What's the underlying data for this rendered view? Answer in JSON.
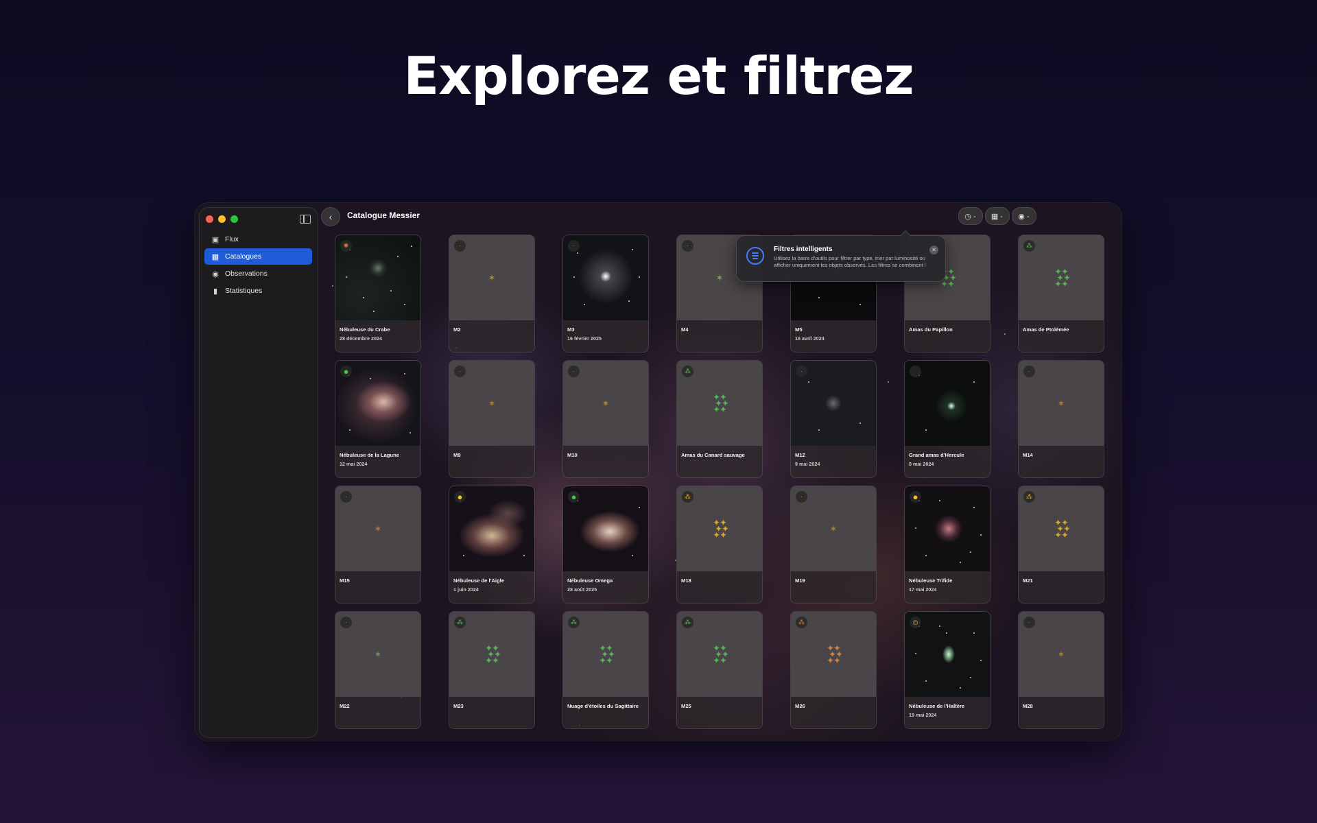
{
  "headline": "Explorez et filtrez",
  "window": {
    "title": "Catalogue Messier",
    "sidebar": {
      "items": [
        {
          "label": "Flux",
          "icon": "photo-stack-icon",
          "glyph": "▣",
          "active": false
        },
        {
          "label": "Catalogues",
          "icon": "photo-grid-icon",
          "glyph": "▦",
          "active": true
        },
        {
          "label": "Observations",
          "icon": "eye-icon",
          "glyph": "◉",
          "active": false
        },
        {
          "label": "Statistiques",
          "icon": "bar-chart-icon",
          "glyph": "▮",
          "active": false
        }
      ]
    },
    "toolbar": {
      "back_glyph": "‹",
      "buttons": [
        {
          "name": "season-filter-button",
          "icon": "clock-filter-icon",
          "glyph": "◷"
        },
        {
          "name": "layout-button",
          "icon": "grid-view-icon",
          "glyph": "▦"
        },
        {
          "name": "visibility-button",
          "icon": "eye-icon",
          "glyph": "◉"
        }
      ],
      "chevron": "⌄"
    },
    "tooltip": {
      "title": "Filtres intelligents",
      "body": "Utilisez la barre d'outils pour filtrer par type, trier par luminosité ou afficher uniquement les objets observés. Les filtres se combinent !",
      "close_glyph": "✕"
    },
    "cards": [
      {
        "name": "Nébuleuse du Crabe",
        "date": "28 décembre 2024",
        "photo": "nebula-small",
        "badge": "supernova",
        "badge_glyph": "✺",
        "badge_color": "#e07a3a"
      },
      {
        "name": "M2",
        "date": "",
        "photo": "",
        "badge": "dim",
        "badge_glyph": "·",
        "badge_color": "#b0a020",
        "glyph": "✶",
        "glyph_color": "#b8a030",
        "glyph_type": "dim"
      },
      {
        "name": "M3",
        "date": "16 février 2025",
        "photo": "globular",
        "badge": "dim",
        "badge_glyph": "·",
        "badge_color": "#9a9a40"
      },
      {
        "name": "M4",
        "date": "",
        "photo": "",
        "badge": "dim",
        "badge_glyph": "·",
        "badge_color": "#8aa060",
        "glyph": "✶",
        "glyph_color": "#8ab060",
        "glyph_type": "dim"
      },
      {
        "name": "M5",
        "date": "16 avril 2024",
        "photo": "globular-small",
        "badge": "dim",
        "badge_glyph": "·",
        "badge_color": "#777"
      },
      {
        "name": "Amas du Papillon",
        "date": "",
        "photo": "",
        "badge": "cluster",
        "badge_glyph": "⁂",
        "badge_color": "#5ab05a",
        "glyph": "✦✦",
        "glyph_color": "#5ab05a",
        "glyph_type": "stars"
      },
      {
        "name": "Amas de Ptolémée",
        "date": "",
        "photo": "",
        "badge": "cluster",
        "badge_glyph": "⁂",
        "badge_color": "#5ab05a",
        "glyph": "✦✦",
        "glyph_color": "#5ab05a",
        "glyph_type": "stars"
      },
      {
        "name": "Nébuleuse de la Lagune",
        "date": "12 mai 2024",
        "photo": "lagoon",
        "badge": "nebula-green",
        "badge_glyph": "●",
        "badge_color": "#4cc04c"
      },
      {
        "name": "M9",
        "date": "",
        "photo": "",
        "badge": "dim",
        "badge_glyph": "·",
        "badge_color": "#b09030",
        "glyph": "✶",
        "glyph_color": "#b89030",
        "glyph_type": "dim"
      },
      {
        "name": "M10",
        "date": "",
        "photo": "",
        "badge": "dim",
        "badge_glyph": "·",
        "badge_color": "#b09030",
        "glyph": "✶",
        "glyph_color": "#b8a030",
        "glyph_type": "dim"
      },
      {
        "name": "Amas du Canard sauvage",
        "date": "",
        "photo": "",
        "badge": "cluster",
        "badge_glyph": "⁂",
        "badge_color": "#5ab05a",
        "glyph": "✦✦",
        "glyph_color": "#5ab05a",
        "glyph_type": "stars"
      },
      {
        "name": "M12",
        "date": "9 mai 2024",
        "photo": "globular-faint",
        "badge": "dim",
        "badge_glyph": "·",
        "badge_color": "#888"
      },
      {
        "name": "Grand amas d'Hercule",
        "date": "8 mai 2024",
        "photo": "hercules",
        "badge": "dim",
        "badge_glyph": "·",
        "badge_color": "#555"
      },
      {
        "name": "M14",
        "date": "",
        "photo": "",
        "badge": "dim",
        "badge_glyph": "·",
        "badge_color": "#b09030",
        "glyph": "✶",
        "glyph_color": "#b89030",
        "glyph_type": "dim"
      },
      {
        "name": "M15",
        "date": "",
        "photo": "",
        "badge": "dim",
        "badge_glyph": "·",
        "badge_color": "#c08030",
        "glyph": "✶",
        "glyph_color": "#c08a30",
        "glyph_type": "dim"
      },
      {
        "name": "Nébuleuse de l'Aigle",
        "date": "1 juin 2024",
        "photo": "eagle",
        "badge": "nebula-yellow",
        "badge_glyph": "●",
        "badge_color": "#f0c030"
      },
      {
        "name": "Nébuleuse Omega",
        "date": "28 août 2025",
        "photo": "omega",
        "badge": "nebula-green",
        "badge_glyph": "●",
        "badge_color": "#4cc04c"
      },
      {
        "name": "M18",
        "date": "",
        "photo": "",
        "badge": "cluster",
        "badge_glyph": "⁂",
        "badge_color": "#d0a830",
        "glyph": "✦✦",
        "glyph_color": "#d0a830",
        "glyph_type": "stars"
      },
      {
        "name": "M19",
        "date": "",
        "photo": "",
        "badge": "dim",
        "badge_glyph": "·",
        "badge_color": "#b09030",
        "glyph": "✶",
        "glyph_color": "#b89030",
        "glyph_type": "dim"
      },
      {
        "name": "Nébuleuse Trifide",
        "date": "17 mai 2024",
        "photo": "trifid",
        "badge": "nebula-yellow",
        "badge_glyph": "●",
        "badge_color": "#f0c030"
      },
      {
        "name": "M21",
        "date": "",
        "photo": "",
        "badge": "cluster",
        "badge_glyph": "⁂",
        "badge_color": "#d0a830",
        "glyph": "✦✦",
        "glyph_color": "#d0a830",
        "glyph_type": "stars"
      },
      {
        "name": "M22",
        "date": "",
        "photo": "",
        "badge": "dim",
        "badge_glyph": "·",
        "badge_color": "#8aa060",
        "glyph": "✶",
        "glyph_color": "#7aa060",
        "glyph_type": "dim"
      },
      {
        "name": "M23",
        "date": "",
        "photo": "",
        "badge": "cluster",
        "badge_glyph": "⁂",
        "badge_color": "#5ab05a",
        "glyph": "✦✦",
        "glyph_color": "#5ab05a",
        "glyph_type": "stars"
      },
      {
        "name": "Nuage d'étoiles du Sagittaire",
        "date": "",
        "photo": "",
        "badge": "cluster",
        "badge_glyph": "⁂",
        "badge_color": "#5ab05a",
        "glyph": "✦✦",
        "glyph_color": "#5ab05a",
        "glyph_type": "stars"
      },
      {
        "name": "M25",
        "date": "",
        "photo": "",
        "badge": "cluster",
        "badge_glyph": "⁂",
        "badge_color": "#5ab05a",
        "glyph": "✦✦",
        "glyph_color": "#5ab05a",
        "glyph_type": "stars"
      },
      {
        "name": "M26",
        "date": "",
        "photo": "",
        "badge": "cluster",
        "badge_glyph": "⁂",
        "badge_color": "#d08040",
        "glyph": "✦✦",
        "glyph_color": "#d08040",
        "glyph_type": "stars"
      },
      {
        "name": "Nébuleuse de l'Haltère",
        "date": "19 mai 2024",
        "photo": "dumbbell",
        "badge": "planetary",
        "badge_glyph": "◎",
        "badge_color": "#e0b030"
      },
      {
        "name": "M28",
        "date": "",
        "photo": "",
        "badge": "dim",
        "badge_glyph": "·",
        "badge_color": "#b09030",
        "glyph": "✶",
        "glyph_color": "#b89030",
        "glyph_type": "dim"
      }
    ]
  }
}
